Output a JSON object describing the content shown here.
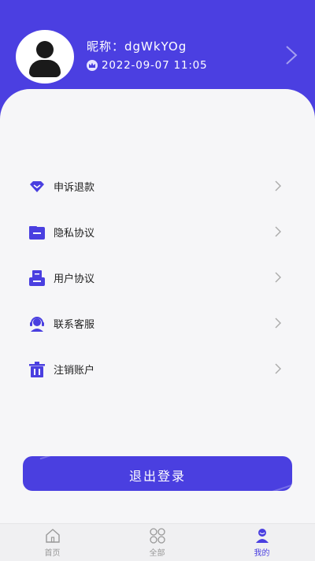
{
  "profile": {
    "nickname": "昵称：dgWkYOg",
    "vip_time": "2022-09-07  11:05"
  },
  "menu": [
    {
      "label": "申诉退款",
      "icon": "heart-diamond-icon"
    },
    {
      "label": "隐私协议",
      "icon": "folder-icon"
    },
    {
      "label": "用户协议",
      "icon": "document-tray-icon"
    },
    {
      "label": "联系客服",
      "icon": "headset-icon"
    },
    {
      "label": "注销账户",
      "icon": "trash-icon"
    }
  ],
  "logout_label": "退出登录",
  "tabs": [
    {
      "label": "首页",
      "icon": "home-icon"
    },
    {
      "label": "全部",
      "icon": "grid-icon"
    },
    {
      "label": "我的",
      "icon": "user-icon"
    }
  ],
  "colors": {
    "accent": "#4a3fe0",
    "card": "#f6f6f8"
  }
}
